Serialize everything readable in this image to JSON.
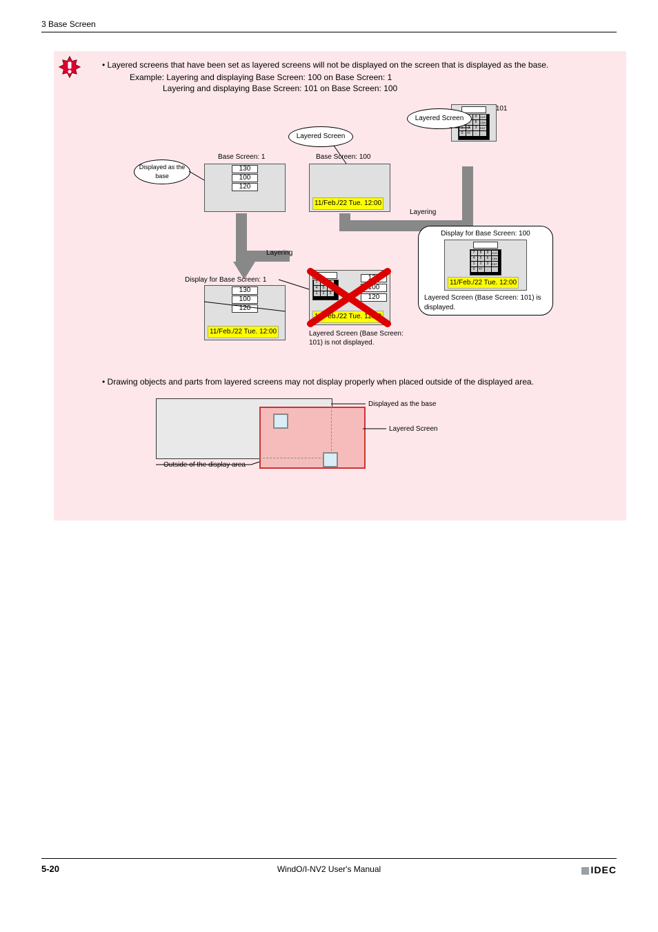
{
  "header": "3 Base Screen",
  "bullet1": "Layered screens that have been set as layered screens will not be displayed on the screen that is displayed as the base.",
  "exampleLabel": "Example:",
  "exLine1": "Layering and displaying Base Screen: 100 on Base Screen: 1",
  "exLine2": "Layering and displaying Base Screen: 101 on Base Screen: 100",
  "d1": {
    "displayedAsBase": "Displayed as the base",
    "bs1": "Base Screen: 1",
    "bs100": "Base Screen: 100",
    "bs101": "Base Screen: 101",
    "layeredScreen": "Layered Screen",
    "vals": {
      "a": "130",
      "b": "100",
      "c": "120"
    },
    "date": "11/Feb./22 Tue. 12:00",
    "layering": "Layering",
    "dispFor1": "Display for Base Screen: 1",
    "dispFor100": "Display for Base Screen: 100",
    "not101": "Layered Screen (Base Screen: 101) is not displayed.",
    "shown101": "Layered Screen (Base Screen: 101) is displayed."
  },
  "bullet2": "Drawing objects and parts from layered screens may not display properly when placed outside of the displayed area.",
  "d2": {
    "base": "Displayed as the base",
    "layer": "Layered Screen",
    "outside": "Outside of the display area"
  },
  "footer": {
    "page": "5-20",
    "title": "WindO/I-NV2 User's Manual",
    "logo": "IDEC"
  }
}
